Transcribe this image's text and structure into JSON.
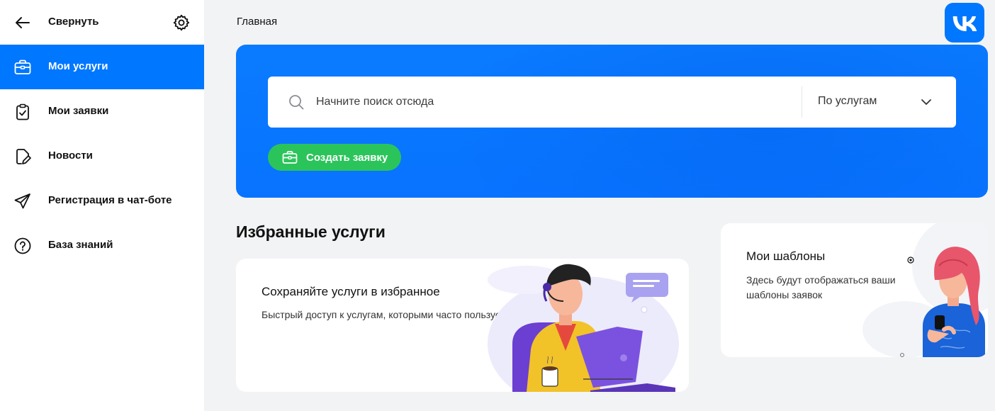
{
  "sidebar": {
    "collapse_label": "Свернуть",
    "items": [
      {
        "label": "Мои услуги",
        "icon": "briefcase-icon",
        "active": true
      },
      {
        "label": "Мои заявки",
        "icon": "clipboard-check-icon",
        "active": false
      },
      {
        "label": "Новости",
        "icon": "document-edit-icon",
        "active": false
      },
      {
        "label": "Регистрация в чат-боте",
        "icon": "paper-plane-icon",
        "active": false
      },
      {
        "label": "База знаний",
        "icon": "question-circle-icon",
        "active": false
      }
    ]
  },
  "header": {
    "breadcrumb": "Главная",
    "logo_text": "VK"
  },
  "banner": {
    "search_placeholder": "Начните поиск отсюда",
    "search_value": "",
    "scope_selected": "По услугам",
    "create_button_label": "Создать заявку"
  },
  "favorites": {
    "title": "Избранные услуги",
    "card_heading": "Сохраняйте услуги в избранное",
    "card_text": "Быстрый доступ к услугам, которыми часто пользуетесь"
  },
  "templates": {
    "heading": "Мои шаблоны",
    "text": "Здесь будут отображаться ваши шаблоны заявок"
  },
  "colors": {
    "accent": "#0077ff",
    "success": "#2bc45b",
    "background": "#f2f3f5"
  }
}
